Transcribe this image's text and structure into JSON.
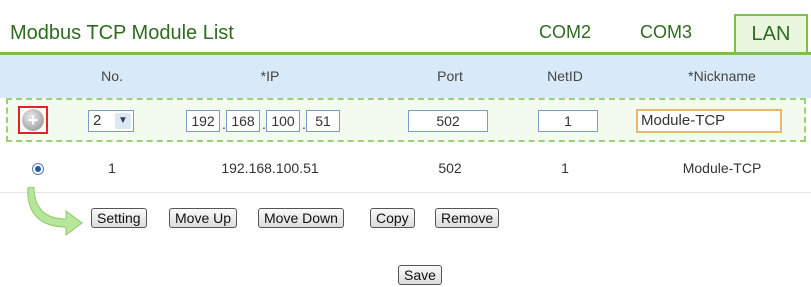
{
  "title": "Modbus TCP Module List",
  "tabs": [
    {
      "label": "COM2",
      "active": false
    },
    {
      "label": "COM3",
      "active": false
    },
    {
      "label": "LAN",
      "active": true
    }
  ],
  "columns": [
    "No.",
    "*IP",
    "Port",
    "NetID",
    "*Nickname"
  ],
  "input_row": {
    "no_selected": "2",
    "ip": [
      "192",
      "168",
      "100",
      "51"
    ],
    "port": "502",
    "netid": "1",
    "nickname": "Module-TCP"
  },
  "rows": [
    {
      "no": "1",
      "ip": "192.168.100.51",
      "port": "502",
      "netid": "1",
      "nickname": "Module-TCP"
    }
  ],
  "actions": [
    "Setting",
    "Move Up",
    "Move Down",
    "Copy",
    "Remove"
  ],
  "save_label": "Save",
  "colors": {
    "accent_green": "#7cbf4f",
    "header_blue": "#d8eaf7",
    "title_green": "#2e6b1f"
  }
}
